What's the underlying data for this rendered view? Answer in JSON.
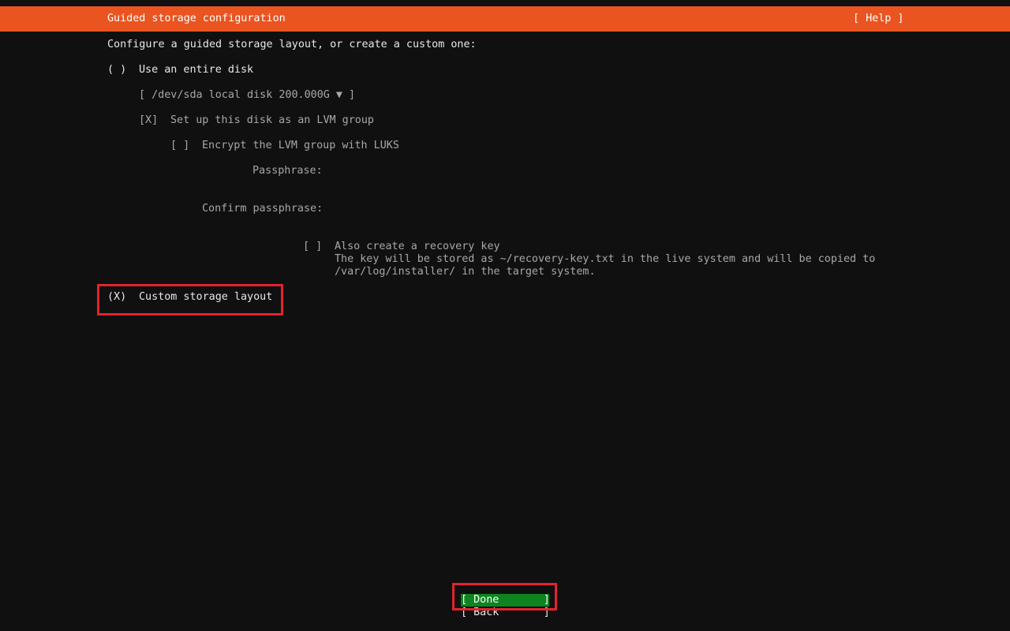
{
  "header": {
    "title": "Guided storage configuration",
    "help": "[ Help ]"
  },
  "intro": "Configure a guided storage layout, or create a custom one:",
  "entire_disk": {
    "radio": "( )",
    "label": "Use an entire disk",
    "disk_select": "[ /dev/sda local disk 200.000G ▼ ]",
    "lvm_checkbox": "[X]",
    "lvm_label": "Set up this disk as an LVM group",
    "luks_checkbox": "[ ]",
    "luks_label": "Encrypt the LVM group with LUKS",
    "passphrase_label": "Passphrase:",
    "passphrase_value": "",
    "confirm_label": "Confirm passphrase:",
    "confirm_value": "",
    "recovery_checkbox": "[ ]",
    "recovery_label": "Also create a recovery key",
    "recovery_note_1": "The key will be stored as ~/recovery-key.txt in the live system and will be copied to",
    "recovery_note_2": "/var/log/installer/ in the target system."
  },
  "custom_layout": {
    "radio": "(X)",
    "label": "Custom storage layout"
  },
  "buttons": {
    "done": "[ Done       ]",
    "back": "[ Back       ]"
  },
  "colors": {
    "header_bg": "#e95420",
    "button_focus_bg": "#0e8420",
    "highlight_border": "#e3232c"
  }
}
